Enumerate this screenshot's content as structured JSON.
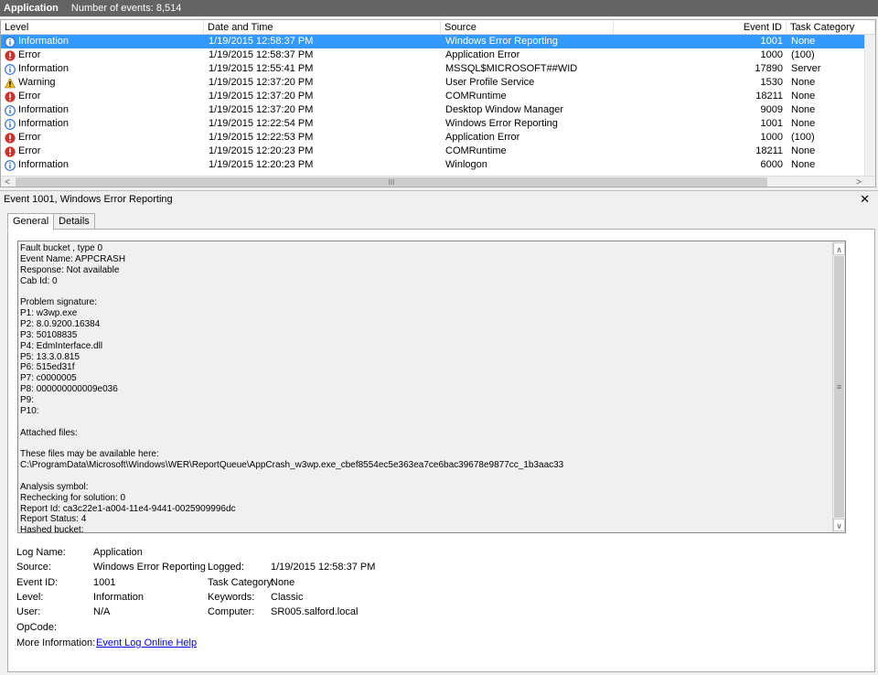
{
  "title_bar": {
    "app": "Application",
    "count_text": "Number of events: 8,514"
  },
  "grid": {
    "columns": [
      "Level",
      "Date and Time",
      "Source",
      "Event ID",
      "Task Category"
    ],
    "rows": [
      {
        "level": "Information",
        "icon": "info",
        "date": "1/19/2015 12:58:37 PM",
        "source": "Windows Error Reporting",
        "event_id": "1001",
        "category": "None",
        "selected": true
      },
      {
        "level": "Error",
        "icon": "error",
        "date": "1/19/2015 12:58:37 PM",
        "source": "Application Error",
        "event_id": "1000",
        "category": "(100)"
      },
      {
        "level": "Information",
        "icon": "info",
        "date": "1/19/2015 12:55:41 PM",
        "source": "MSSQL$MICROSOFT##WID",
        "event_id": "17890",
        "category": "Server"
      },
      {
        "level": "Warning",
        "icon": "warning",
        "date": "1/19/2015 12:37:20 PM",
        "source": "User Profile Service",
        "event_id": "1530",
        "category": "None"
      },
      {
        "level": "Error",
        "icon": "error",
        "date": "1/19/2015 12:37:20 PM",
        "source": "COMRuntime",
        "event_id": "18211",
        "category": "None"
      },
      {
        "level": "Information",
        "icon": "info",
        "date": "1/19/2015 12:37:20 PM",
        "source": "Desktop Window Manager",
        "event_id": "9009",
        "category": "None"
      },
      {
        "level": "Information",
        "icon": "info",
        "date": "1/19/2015 12:22:54 PM",
        "source": "Windows Error Reporting",
        "event_id": "1001",
        "category": "None"
      },
      {
        "level": "Error",
        "icon": "error",
        "date": "1/19/2015 12:22:53 PM",
        "source": "Application Error",
        "event_id": "1000",
        "category": "(100)"
      },
      {
        "level": "Error",
        "icon": "error",
        "date": "1/19/2015 12:20:23 PM",
        "source": "COMRuntime",
        "event_id": "18211",
        "category": "None"
      },
      {
        "level": "Information",
        "icon": "info",
        "date": "1/19/2015 12:20:23 PM",
        "source": "Winlogon",
        "event_id": "6000",
        "category": "None"
      }
    ],
    "hscroll_grip": "III"
  },
  "detail": {
    "header": "Event 1001, Windows Error Reporting",
    "close_glyph": "✕",
    "tabs": [
      {
        "label": "General",
        "active": true
      },
      {
        "label": "Details",
        "active": false
      }
    ],
    "description_lines": [
      "Fault bucket , type 0",
      "Event Name: APPCRASH",
      "Response: Not available",
      "Cab Id: 0",
      "",
      "Problem signature:",
      "P1: w3wp.exe",
      "P2: 8.0.9200.16384",
      "P3: 50108835",
      "P4: EdmInterface.dll",
      "P5: 13.3.0.815",
      "P6: 515ed31f",
      "P7: c0000005",
      "P8: 000000000009e036",
      "P9: ",
      "P10: ",
      "",
      "Attached files:",
      "",
      "These files may be available here:",
      "C:\\ProgramData\\Microsoft\\Windows\\WER\\ReportQueue\\AppCrash_w3wp.exe_cbef8554ec5e363ea7ce6bac39678e9877cc_1b3aac33",
      "",
      "Analysis symbol: ",
      "Rechecking for solution: 0",
      "Report Id: ca3c22e1-a004-11e4-9441-0025909996dc",
      "Report Status: 4",
      "Hashed bucket: "
    ],
    "properties": {
      "log_name_label": "Log Name:",
      "log_name": "Application",
      "source_label": "Source:",
      "source": "Windows Error Reporting",
      "logged_label": "Logged:",
      "logged": "1/19/2015 12:58:37 PM",
      "event_id_label": "Event ID:",
      "event_id": "1001",
      "task_category_label": "Task Category:",
      "task_category": "None",
      "level_label": "Level:",
      "level": "Information",
      "keywords_label": "Keywords:",
      "keywords": "Classic",
      "user_label": "User:",
      "user": "N/A",
      "computer_label": "Computer:",
      "computer": "SR005.salford.local",
      "opcode_label": "OpCode:",
      "opcode": "",
      "more_info_label": "More Information:",
      "more_info_link": "Event Log Online Help"
    }
  },
  "colors": {
    "selection": "#3399ff",
    "title_bar": "#636363",
    "info": "#2f6fcf",
    "error": "#d0312d",
    "warning": "#f2c318"
  }
}
